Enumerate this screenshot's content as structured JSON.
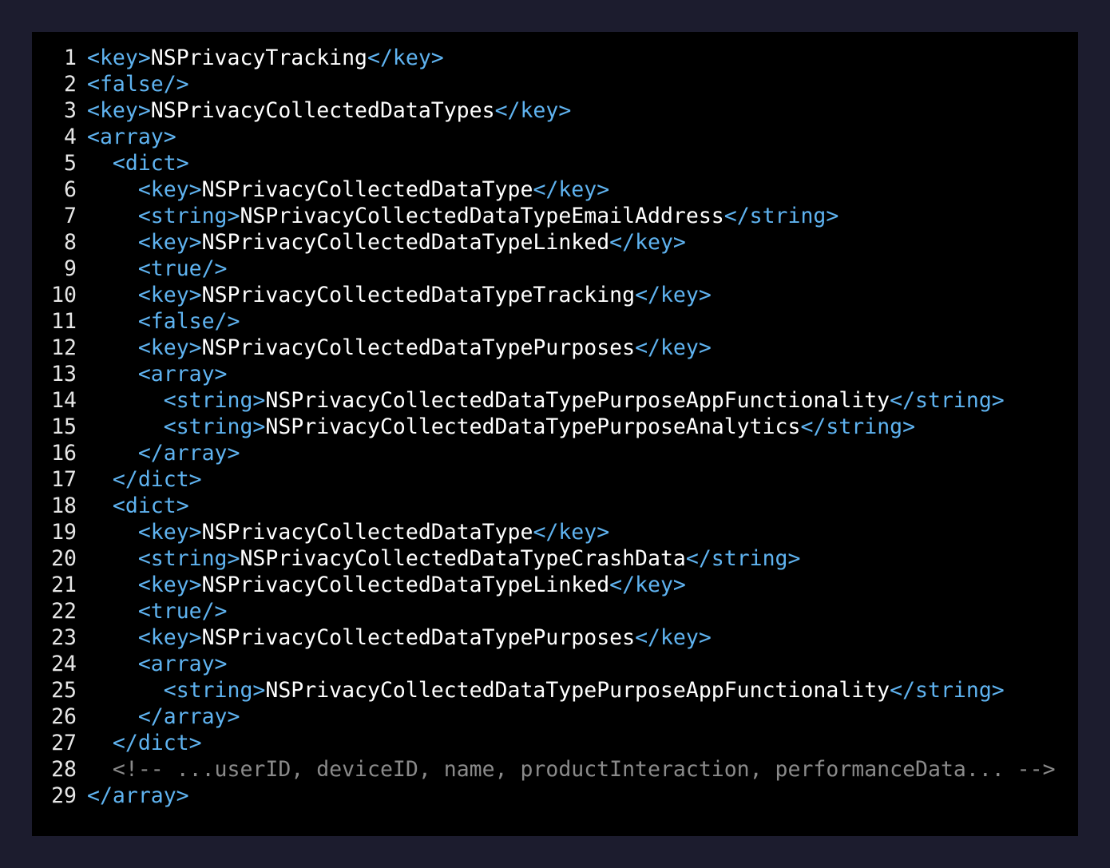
{
  "colors": {
    "page_background": "#1c1c2e",
    "editor_background": "#000000",
    "tag": "#5fb3f0",
    "text": "#ffffff",
    "comment": "#8a8a8a",
    "line_number": "#e6e6e6"
  },
  "code": {
    "lines": [
      {
        "number": "1",
        "indent": "",
        "tokens": [
          {
            "type": "tag",
            "text": "<key>"
          },
          {
            "type": "text",
            "text": "NSPrivacyTracking"
          },
          {
            "type": "tag",
            "text": "</key>"
          }
        ]
      },
      {
        "number": "2",
        "indent": "",
        "tokens": [
          {
            "type": "tag",
            "text": "<false/>"
          }
        ]
      },
      {
        "number": "3",
        "indent": "",
        "tokens": [
          {
            "type": "tag",
            "text": "<key>"
          },
          {
            "type": "text",
            "text": "NSPrivacyCollectedDataTypes"
          },
          {
            "type": "tag",
            "text": "</key>"
          }
        ]
      },
      {
        "number": "4",
        "indent": "",
        "tokens": [
          {
            "type": "tag",
            "text": "<array>"
          }
        ]
      },
      {
        "number": "5",
        "indent": "  ",
        "tokens": [
          {
            "type": "tag",
            "text": "<dict>"
          }
        ]
      },
      {
        "number": "6",
        "indent": "    ",
        "tokens": [
          {
            "type": "tag",
            "text": "<key>"
          },
          {
            "type": "text",
            "text": "NSPrivacyCollectedDataType"
          },
          {
            "type": "tag",
            "text": "</key>"
          }
        ]
      },
      {
        "number": "7",
        "indent": "    ",
        "tokens": [
          {
            "type": "tag",
            "text": "<string>"
          },
          {
            "type": "text",
            "text": "NSPrivacyCollectedDataTypeEmailAddress"
          },
          {
            "type": "tag",
            "text": "</string>"
          }
        ]
      },
      {
        "number": "8",
        "indent": "    ",
        "tokens": [
          {
            "type": "tag",
            "text": "<key>"
          },
          {
            "type": "text",
            "text": "NSPrivacyCollectedDataTypeLinked"
          },
          {
            "type": "tag",
            "text": "</key>"
          }
        ]
      },
      {
        "number": "9",
        "indent": "    ",
        "tokens": [
          {
            "type": "tag",
            "text": "<true/>"
          }
        ]
      },
      {
        "number": "10",
        "indent": "    ",
        "tokens": [
          {
            "type": "tag",
            "text": "<key>"
          },
          {
            "type": "text",
            "text": "NSPrivacyCollectedDataTypeTracking"
          },
          {
            "type": "tag",
            "text": "</key>"
          }
        ]
      },
      {
        "number": "11",
        "indent": "    ",
        "tokens": [
          {
            "type": "tag",
            "text": "<false/>"
          }
        ]
      },
      {
        "number": "12",
        "indent": "    ",
        "tokens": [
          {
            "type": "tag",
            "text": "<key>"
          },
          {
            "type": "text",
            "text": "NSPrivacyCollectedDataTypePurposes"
          },
          {
            "type": "tag",
            "text": "</key>"
          }
        ]
      },
      {
        "number": "13",
        "indent": "    ",
        "tokens": [
          {
            "type": "tag",
            "text": "<array>"
          }
        ]
      },
      {
        "number": "14",
        "indent": "      ",
        "tokens": [
          {
            "type": "tag",
            "text": "<string>"
          },
          {
            "type": "text",
            "text": "NSPrivacyCollectedDataTypePurposeAppFunctionality"
          },
          {
            "type": "tag",
            "text": "</string>"
          }
        ]
      },
      {
        "number": "15",
        "indent": "      ",
        "tokens": [
          {
            "type": "tag",
            "text": "<string>"
          },
          {
            "type": "text",
            "text": "NSPrivacyCollectedDataTypePurposeAnalytics"
          },
          {
            "type": "tag",
            "text": "</string>"
          }
        ]
      },
      {
        "number": "16",
        "indent": "    ",
        "tokens": [
          {
            "type": "tag",
            "text": "</array>"
          }
        ]
      },
      {
        "number": "17",
        "indent": "  ",
        "tokens": [
          {
            "type": "tag",
            "text": "</dict>"
          }
        ]
      },
      {
        "number": "18",
        "indent": "  ",
        "tokens": [
          {
            "type": "tag",
            "text": "<dict>"
          }
        ]
      },
      {
        "number": "19",
        "indent": "    ",
        "tokens": [
          {
            "type": "tag",
            "text": "<key>"
          },
          {
            "type": "text",
            "text": "NSPrivacyCollectedDataType"
          },
          {
            "type": "tag",
            "text": "</key>"
          }
        ]
      },
      {
        "number": "20",
        "indent": "    ",
        "tokens": [
          {
            "type": "tag",
            "text": "<string>"
          },
          {
            "type": "text",
            "text": "NSPrivacyCollectedDataTypeCrashData"
          },
          {
            "type": "tag",
            "text": "</string>"
          }
        ]
      },
      {
        "number": "21",
        "indent": "    ",
        "tokens": [
          {
            "type": "tag",
            "text": "<key>"
          },
          {
            "type": "text",
            "text": "NSPrivacyCollectedDataTypeLinked"
          },
          {
            "type": "tag",
            "text": "</key>"
          }
        ]
      },
      {
        "number": "22",
        "indent": "    ",
        "tokens": [
          {
            "type": "tag",
            "text": "<true/>"
          }
        ]
      },
      {
        "number": "23",
        "indent": "    ",
        "tokens": [
          {
            "type": "tag",
            "text": "<key>"
          },
          {
            "type": "text",
            "text": "NSPrivacyCollectedDataTypePurposes"
          },
          {
            "type": "tag",
            "text": "</key>"
          }
        ]
      },
      {
        "number": "24",
        "indent": "    ",
        "tokens": [
          {
            "type": "tag",
            "text": "<array>"
          }
        ]
      },
      {
        "number": "25",
        "indent": "      ",
        "tokens": [
          {
            "type": "tag",
            "text": "<string>"
          },
          {
            "type": "text",
            "text": "NSPrivacyCollectedDataTypePurposeAppFunctionality"
          },
          {
            "type": "tag",
            "text": "</string>"
          }
        ]
      },
      {
        "number": "26",
        "indent": "    ",
        "tokens": [
          {
            "type": "tag",
            "text": "</array>"
          }
        ]
      },
      {
        "number": "27",
        "indent": "  ",
        "tokens": [
          {
            "type": "tag",
            "text": "</dict>"
          }
        ]
      },
      {
        "number": "28",
        "indent": "  ",
        "tokens": [
          {
            "type": "comment",
            "text": "<!-- ...userID, deviceID, name, productInteraction, performanceData... -->"
          }
        ]
      },
      {
        "number": "29",
        "indent": "",
        "tokens": [
          {
            "type": "tag",
            "text": "</array>"
          }
        ]
      }
    ]
  }
}
